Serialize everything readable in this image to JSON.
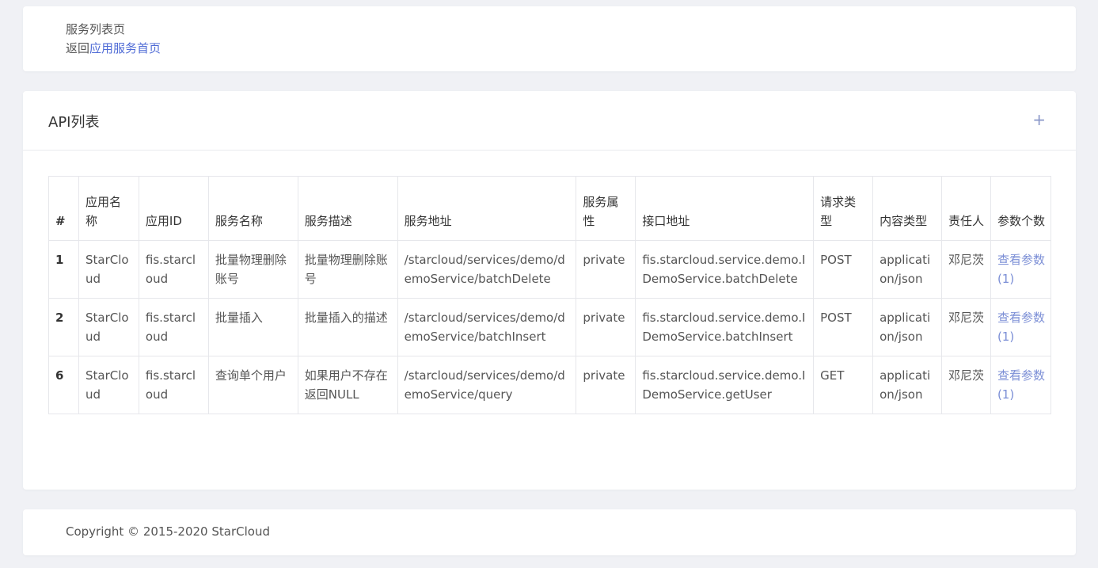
{
  "breadcrumb": {
    "title": "服务列表页",
    "back_prefix": "返回",
    "back_link": "应用服务首页"
  },
  "api_card": {
    "title": "API列表",
    "add_icon": "plus-icon",
    "add_glyph": "+"
  },
  "table": {
    "headers": [
      "#",
      "应用名称",
      "应用ID",
      "服务名称",
      "服务描述",
      "服务地址",
      "服务属性",
      "接口地址",
      "请求类型",
      "内容类型",
      "责任人",
      "参数个数"
    ],
    "rows": [
      {
        "id": "1",
        "app_name": "StarCloud",
        "app_id": "fis.starcloud",
        "service_name": "批量物理删除账号",
        "service_desc": "批量物理删除账号",
        "service_url": "/starcloud/services/demo/demoService/batchDelete",
        "service_attr": "private",
        "interface": "fis.starcloud.service.demo.IDemoService.batchDelete",
        "method": "POST",
        "content_type": "application/json",
        "owner": "邓尼茨",
        "params": "查看参数(1)"
      },
      {
        "id": "2",
        "app_name": "StarCloud",
        "app_id": "fis.starcloud",
        "service_name": "批量插入",
        "service_desc": "批量插入的描述",
        "service_url": "/starcloud/services/demo/demoService/batchInsert",
        "service_attr": "private",
        "interface": "fis.starcloud.service.demo.IDemoService.batchInsert",
        "method": "POST",
        "content_type": "application/json",
        "owner": "邓尼茨",
        "params": "查看参数(1)"
      },
      {
        "id": "6",
        "app_name": "StarCloud",
        "app_id": "fis.starcloud",
        "service_name": "查询单个用户",
        "service_desc": "如果用户不存在返回NULL",
        "service_url": "/starcloud/services/demo/demoService/query",
        "service_attr": "private",
        "interface": "fis.starcloud.service.demo.IDemoService.getUser",
        "method": "GET",
        "content_type": "application/json",
        "owner": "邓尼茨",
        "params": "查看参数(1)"
      }
    ]
  },
  "footer": {
    "copyright": "Copyright © 2015-2020 StarCloud"
  },
  "colors": {
    "link": "#4f6bd6",
    "param_link": "#7c8fd6",
    "background": "#f0f1f5"
  }
}
